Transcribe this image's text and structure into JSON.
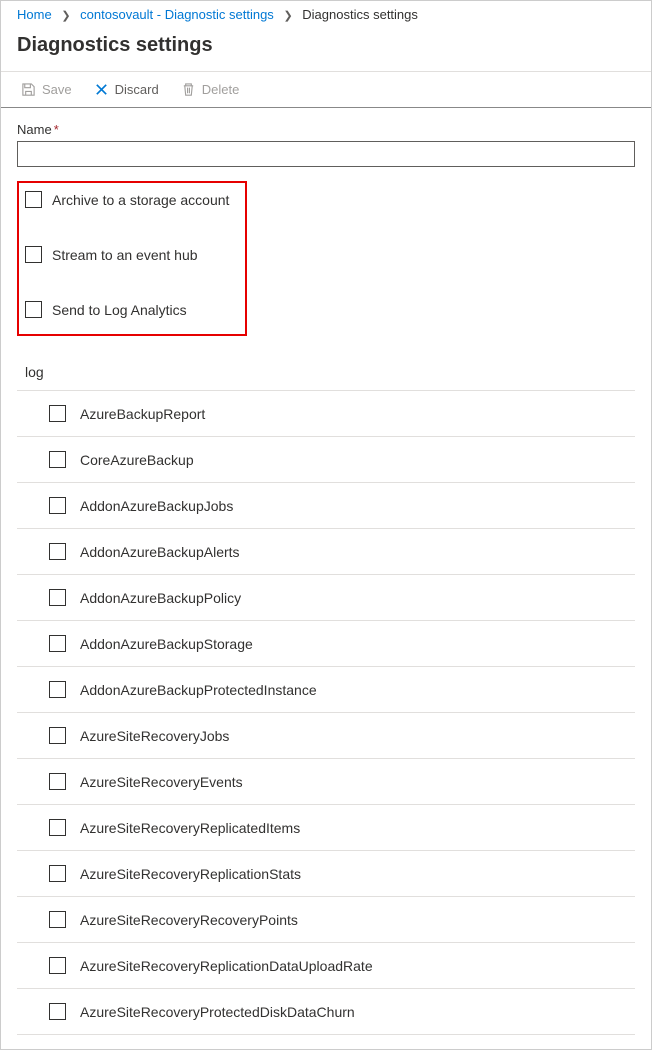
{
  "breadcrumb": {
    "home": "Home",
    "vault": "contosovault - Diagnostic settings",
    "current": "Diagnostics settings"
  },
  "page_title": "Diagnostics settings",
  "toolbar": {
    "save_label": "Save",
    "discard_label": "Discard",
    "delete_label": "Delete"
  },
  "form": {
    "name_label": "Name",
    "name_value": ""
  },
  "destinations": [
    {
      "label": "Archive to a storage account"
    },
    {
      "label": "Stream to an event hub"
    },
    {
      "label": "Send to Log Analytics"
    }
  ],
  "log_section_label": "log",
  "logs": [
    {
      "label": "AzureBackupReport"
    },
    {
      "label": "CoreAzureBackup"
    },
    {
      "label": "AddonAzureBackupJobs"
    },
    {
      "label": "AddonAzureBackupAlerts"
    },
    {
      "label": "AddonAzureBackupPolicy"
    },
    {
      "label": "AddonAzureBackupStorage"
    },
    {
      "label": "AddonAzureBackupProtectedInstance"
    },
    {
      "label": "AzureSiteRecoveryJobs"
    },
    {
      "label": "AzureSiteRecoveryEvents"
    },
    {
      "label": "AzureSiteRecoveryReplicatedItems"
    },
    {
      "label": "AzureSiteRecoveryReplicationStats"
    },
    {
      "label": "AzureSiteRecoveryRecoveryPoints"
    },
    {
      "label": "AzureSiteRecoveryReplicationDataUploadRate"
    },
    {
      "label": "AzureSiteRecoveryProtectedDiskDataChurn"
    }
  ]
}
